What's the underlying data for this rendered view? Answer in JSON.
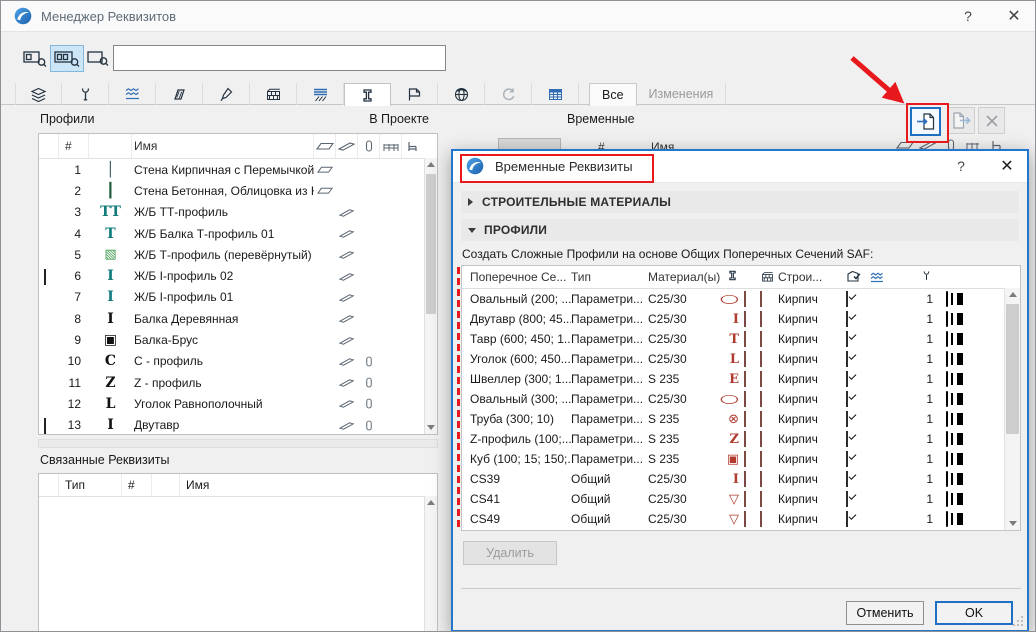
{
  "window": {
    "title": "Менеджер Реквизитов",
    "help_label": "?",
    "close_label": "✕"
  },
  "toolbar": {
    "search_value": "",
    "search_placeholder": ""
  },
  "tabs": {
    "all_label": "Все",
    "changes_label": "Изменения",
    "selected_tab": "profiles"
  },
  "left_panel": {
    "title": "Профили",
    "right_title": "В Проекте",
    "columns": {
      "num": "#",
      "name": "Имя"
    },
    "rows": [
      {
        "checked": false,
        "num": "1",
        "glyph": "│",
        "glyph_class": "g-wall1",
        "name": "Стена Кирпичная с Перемычкой",
        "wall": true,
        "beam": false,
        "column": false
      },
      {
        "checked": false,
        "num": "2",
        "glyph": "┃",
        "glyph_class": "g-wall2",
        "name": "Стена Бетонная, Облицовка из Кир...",
        "wall": true,
        "beam": false,
        "column": false
      },
      {
        "checked": false,
        "num": "3",
        "glyph": "ТТ",
        "glyph_class": "g-teal",
        "name": "Ж/Б ТТ-профиль",
        "wall": false,
        "beam": true,
        "column": false
      },
      {
        "checked": false,
        "num": "4",
        "glyph": "Т",
        "glyph_class": "g-teal",
        "name": "Ж/Б Балка Т-профиль 01",
        "wall": false,
        "beam": true,
        "column": false
      },
      {
        "checked": false,
        "num": "5",
        "glyph": "▧",
        "glyph_class": "g-green",
        "name": "Ж/Б Т-профиль (перевёрнутый)",
        "wall": false,
        "beam": true,
        "column": false
      },
      {
        "checked": true,
        "num": "6",
        "glyph": "I",
        "glyph_class": "g-teal",
        "name": "Ж/Б I-профиль 02",
        "wall": false,
        "beam": true,
        "column": false
      },
      {
        "checked": false,
        "num": "7",
        "glyph": "I",
        "glyph_class": "g-teal",
        "name": "Ж/Б I-профиль 01",
        "wall": false,
        "beam": true,
        "column": false
      },
      {
        "checked": false,
        "num": "8",
        "glyph": "I",
        "glyph_class": "g-black",
        "name": "Балка Деревянная",
        "wall": false,
        "beam": true,
        "column": false
      },
      {
        "checked": false,
        "num": "9",
        "glyph": "▣",
        "glyph_class": "g-black",
        "name": "Балка-Брус",
        "wall": false,
        "beam": true,
        "column": false
      },
      {
        "checked": false,
        "num": "10",
        "glyph": "С",
        "glyph_class": "g-black",
        "name": "С - профиль",
        "wall": false,
        "beam": true,
        "column": true
      },
      {
        "checked": false,
        "num": "11",
        "glyph": "Z",
        "glyph_class": "g-black",
        "name": "Z - профиль",
        "wall": false,
        "beam": true,
        "column": true
      },
      {
        "checked": false,
        "num": "12",
        "glyph": "L",
        "glyph_class": "g-black",
        "name": "Уголок Равнополочный",
        "wall": false,
        "beam": true,
        "column": true
      },
      {
        "checked": true,
        "num": "13",
        "glyph": "I",
        "glyph_class": "g-black",
        "name": "Двутавр",
        "wall": false,
        "beam": true,
        "column": true
      }
    ],
    "linked": {
      "title": "Связанные Реквизиты",
      "col_type": "Тип",
      "col_num": "#",
      "col_name": "Имя"
    }
  },
  "right_panel": {
    "title": "Временные",
    "col_num": "#",
    "col_name": "Имя"
  },
  "modal": {
    "title": "Временные Реквизиты",
    "help_label": "?",
    "close_label": "✕",
    "section_materials": "СТРОИТЕЛЬНЫЕ МАТЕРИАЛЫ",
    "section_profiles": "ПРОФИЛИ",
    "instruction": "Создать Сложные Профили на основе Общих Поперечных Сечений SAF:",
    "columns": {
      "name": "Поперечное Се...",
      "type": "Тип",
      "material": "Материал(ы)",
      "building": "Строи..."
    },
    "rows": [
      {
        "name": "Овальный (200; ...",
        "type": "Параметри...",
        "material": "C25/30",
        "glyph": "○",
        "glyph_class": "g-oval",
        "bmat": "Кирпич",
        "checked": true,
        "pen": "1"
      },
      {
        "name": "Двутавр (800; 45...",
        "type": "Параметри...",
        "material": "C25/30",
        "glyph": "I",
        "glyph_class": "",
        "bmat": "Кирпич",
        "checked": true,
        "pen": "1"
      },
      {
        "name": "Тавр (600; 450; 1...",
        "type": "Параметри...",
        "material": "C25/30",
        "glyph": "Т",
        "glyph_class": "",
        "bmat": "Кирпич",
        "checked": true,
        "pen": "1"
      },
      {
        "name": "Уголок (600; 450...",
        "type": "Параметри...",
        "material": "C25/30",
        "glyph": "L",
        "glyph_class": "",
        "bmat": "Кирпич",
        "checked": true,
        "pen": "1"
      },
      {
        "name": "Швеллер (300; 1...",
        "type": "Параметри...",
        "material": "S 235",
        "glyph": "E",
        "glyph_class": "",
        "bmat": "Кирпич",
        "checked": true,
        "pen": "1"
      },
      {
        "name": "Овальный (300; ...",
        "type": "Параметри...",
        "material": "C25/30",
        "glyph": "○",
        "glyph_class": "g-oval",
        "bmat": "Кирпич",
        "checked": true,
        "pen": "1"
      },
      {
        "name": "Труба (300; 10)",
        "type": "Параметри...",
        "material": "S 235",
        "glyph": "⊗",
        "glyph_class": "g-sym",
        "bmat": "Кирпич",
        "checked": true,
        "pen": "1"
      },
      {
        "name": "Z-профиль (100;...",
        "type": "Параметри...",
        "material": "S 235",
        "glyph": "Z",
        "glyph_class": "",
        "bmat": "Кирпич",
        "checked": true,
        "pen": "1"
      },
      {
        "name": "Куб (100; 15; 150;...",
        "type": "Параметри...",
        "material": "S 235",
        "glyph": "▣",
        "glyph_class": "g-sym",
        "bmat": "Кирпич",
        "checked": true,
        "pen": "1"
      },
      {
        "name": "CS39",
        "type": "Общий",
        "material": "C25/30",
        "glyph": "I",
        "glyph_class": "",
        "bmat": "Кирпич",
        "checked": true,
        "pen": "1"
      },
      {
        "name": "CS41",
        "type": "Общий",
        "material": "C25/30",
        "glyph": "▽",
        "glyph_class": "g-sym",
        "bmat": "Кирпич",
        "checked": true,
        "pen": "1"
      },
      {
        "name": "CS49",
        "type": "Общий",
        "material": "C25/30",
        "glyph": "▽",
        "glyph_class": "g-sym",
        "bmat": "Кирпич",
        "checked": true,
        "pen": "1"
      }
    ],
    "delete_label": "Удалить",
    "cancel_label": "Отменить",
    "ok_label": "OK"
  },
  "colors": {
    "accent_blue": "#1f6fc5",
    "annotation_red": "#e8191c",
    "brick_swatch": "#b97164",
    "profile_red": "#b03a2e",
    "teal_glyph": "#0f7b7b"
  }
}
